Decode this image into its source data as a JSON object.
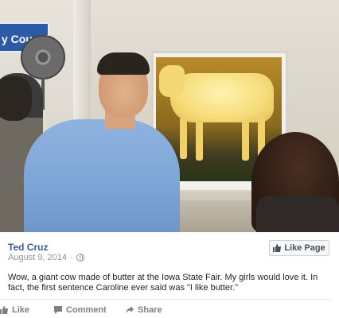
{
  "photo": {
    "sign_text": "y Council"
  },
  "post": {
    "author": "Ted Cruz",
    "date": "August 9, 2014",
    "separator": "·",
    "like_page_label": "Like Page",
    "text": "Wow, a giant cow made of butter at the Iowa State Fair. My girls would love it. In fact, the first sentence Caroline ever said was \"I like butter.\""
  },
  "actions": {
    "like": "Like",
    "comment": "Comment",
    "share": "Share"
  },
  "colors": {
    "author_link": "#3b5998",
    "meta_gray": "#90949c"
  },
  "icons": {
    "privacy": "globe-icon",
    "like_page": "thumbs-up-icon",
    "like": "thumbs-up-icon",
    "comment": "comment-icon",
    "share": "share-arrow-icon"
  }
}
